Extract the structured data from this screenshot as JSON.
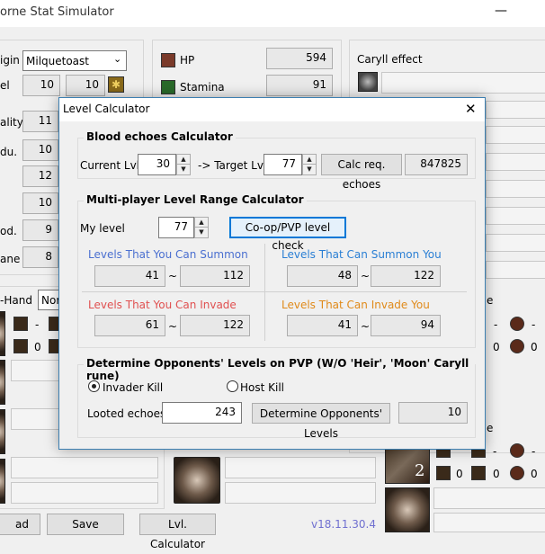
{
  "app": {
    "title": "orne Stat Simulator",
    "version": "v18.11.30.4",
    "left_labels": [
      "igin",
      "el",
      "ality",
      "du.",
      "od.",
      "ane"
    ],
    "origin_value": "Milquetoast",
    "level_values": [
      "10",
      "10"
    ],
    "stat_values": [
      "11",
      "10",
      "12",
      "10",
      "9",
      "8"
    ],
    "hp_label": "HP",
    "hp_value": "594",
    "stamina_label": "Stamina",
    "stamina_value": "91",
    "caryll_label": "Caryll effect",
    "hand_label": "-Hand",
    "hand_select": "Nor",
    "right_header_fragment": "e",
    "right_header_fragment2": "e",
    "equip_row_values": [
      "0",
      "-",
      "0",
      "-",
      "0",
      "0",
      "0",
      "0"
    ],
    "portrait_badge": "2",
    "buttons": {
      "load": "ad",
      "save": "Save",
      "lvl_calc": "Lvl. Calculator"
    }
  },
  "dialog": {
    "title": "Level Calculator",
    "close_glyph": "✕",
    "blood_echoes": {
      "title": "Blood echoes Calculator",
      "current_label": "Current Lvl.",
      "current_value": "30",
      "target_label": "-> Target Lvl.",
      "target_value": "77",
      "calc_button": "Calc req. echoes",
      "result": "847825"
    },
    "multiplayer": {
      "title": "Multi-player Level Range Calculator",
      "my_level_label": "My level",
      "my_level_value": "77",
      "check_button": "Co-op/PVP level check",
      "summon_label": "Levels That You Can Summon",
      "summon_min": "41",
      "summon_max": "112",
      "summoned_label": "Levels That Can Summon You",
      "summoned_min": "48",
      "summoned_max": "122",
      "invade_label": "Levels That You Can Invade",
      "invade_min": "61",
      "invade_max": "122",
      "invaded_label": "Levels That Can Invade You",
      "invaded_min": "41",
      "invaded_max": "94",
      "tilde": "~"
    },
    "pvp": {
      "title": "Determine Opponents' Levels on PVP (W/O 'Heir', 'Moon' Caryll rune)",
      "invader_kill": "Invader Kill",
      "host_kill": "Host Kill",
      "looted_label": "Looted echoes",
      "looted_value": "243",
      "determine_button": "Determine Opponents' Levels",
      "result": "10"
    }
  },
  "colors": {
    "summon": "#4a6fd0",
    "summoned": "#2a7fd4",
    "invade": "#e05050",
    "invaded": "#e08a1a",
    "version": "#7070d0"
  }
}
